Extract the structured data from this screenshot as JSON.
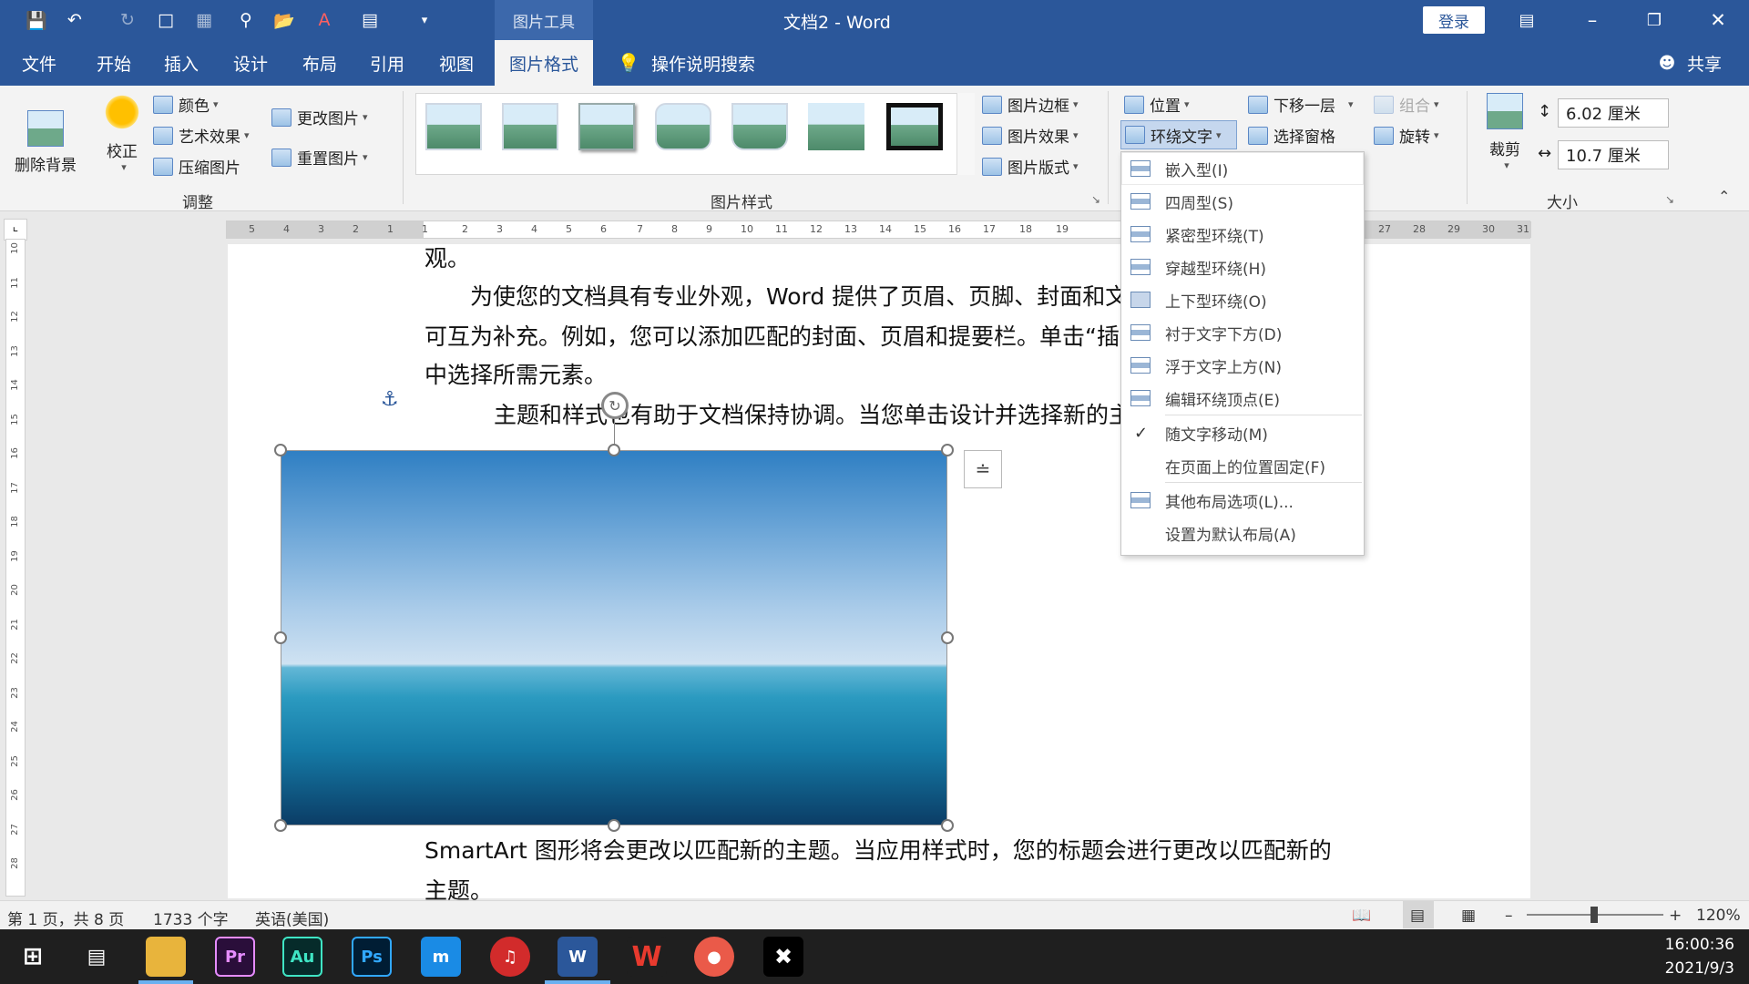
{
  "window": {
    "context_tab": "图片工具",
    "title": "文档2  -  Word",
    "login": "登录"
  },
  "tabs": [
    "文件",
    "开始",
    "插入",
    "设计",
    "布局",
    "引用",
    "视图",
    "图片格式"
  ],
  "search_hint": "操作说明搜索",
  "share": "共享",
  "ribbon": {
    "remove_bg": "删除背景",
    "correct": "校正",
    "color": "颜色",
    "artistic": "艺术效果",
    "compress": "压缩图片",
    "change_pic": "更改图片",
    "reset_pic": "重置图片",
    "group_adjust": "调整",
    "group_styles": "图片样式",
    "pic_border": "图片边框",
    "pic_effects": "图片效果",
    "pic_layout": "图片版式",
    "position": "位置",
    "wrap_text": "环绕文字",
    "send_backward": "下移一层",
    "selection_pane": "选择窗格",
    "group": "组合",
    "rotate": "旋转",
    "crop": "裁剪",
    "height": "6.02 厘米",
    "width": "10.7 厘米",
    "group_size": "大小"
  },
  "ruler": [
    "5",
    "4",
    "3",
    "2",
    "1",
    "1",
    "2",
    "3",
    "4",
    "5",
    "6",
    "7",
    "8",
    "9",
    "10",
    "11",
    "12",
    "13",
    "14",
    "15",
    "16",
    "17",
    "18",
    "19",
    "27",
    "28",
    "29",
    "30",
    "31"
  ],
  "vruler": [
    "10",
    "11",
    "12",
    "13",
    "14",
    "15",
    "16",
    "17",
    "18",
    "19",
    "20",
    "21",
    "22",
    "23",
    "24",
    "25",
    "26",
    "27",
    "28"
  ],
  "document": {
    "line0": "观。",
    "line1": "为使您的文档具有专业外观，Word 提供了页眉、页脚、封面和文",
    "line2": "可互为补充。例如，您可以添加匹配的封面、页眉和提要栏。单击“插",
    "line3": "中选择所需元素。",
    "line4": "主题和样式也有助于文档保持协调。当您单击设计并选择新的主",
    "line5": "SmartArt 图形将会更改以匹配新的主题。当应用样式时，您的标题会进行更改以匹配新的",
    "line6": "主题。"
  },
  "wrap_menu": [
    "嵌入型(I)",
    "四周型(S)",
    "紧密型环绕(T)",
    "穿越型环绕(H)",
    "上下型环绕(O)",
    "衬于文字下方(D)",
    "浮于文字上方(N)",
    "编辑环绕顶点(E)",
    "随文字移动(M)",
    "在页面上的位置固定(F)",
    "其他布局选项(L)...",
    "设置为默认布局(A)"
  ],
  "status": {
    "page": "第 1 页，共 8 页",
    "words": "1733 个字",
    "lang": "英语(美国)",
    "zoom": "120%"
  },
  "taskbar": {
    "time": "16:00:36",
    "date": "2021/9/3"
  }
}
